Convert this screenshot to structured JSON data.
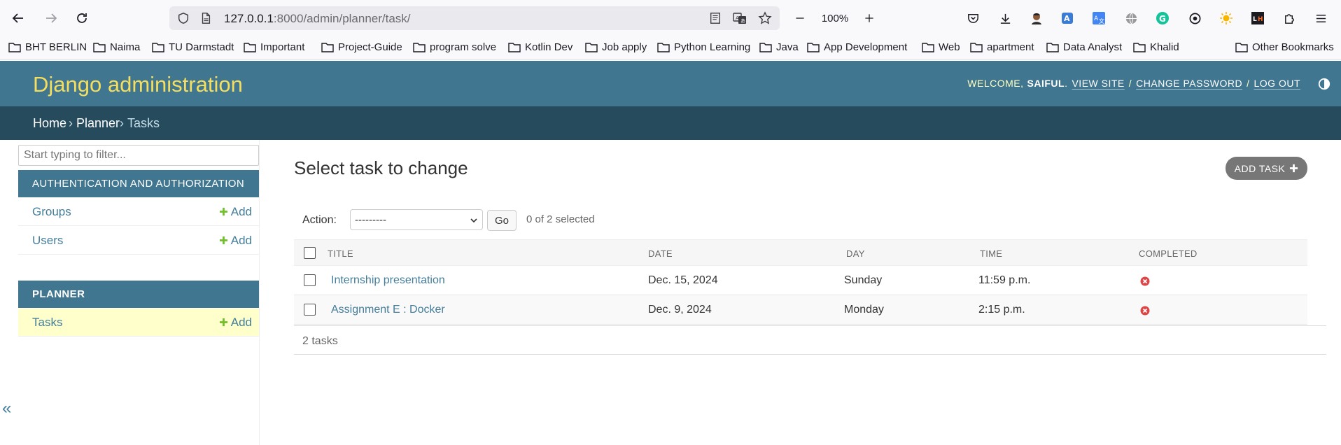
{
  "browser": {
    "url_host": "127.0.0.1",
    "url_rest": ":8000/admin/planner/task/",
    "zoom": "100%"
  },
  "bookmarks": [
    "BHT BERLIN",
    "Naima",
    "TU Darmstadt",
    "Important",
    "Project-Guide",
    "program solve",
    "Kotlin Dev",
    "Job apply",
    "Python Learning",
    "Java",
    "App Development",
    "Web",
    "apartment",
    "Data Analyst",
    "Khalid"
  ],
  "other_bookmarks": "Other Bookmarks",
  "header": {
    "brand": "Django administration",
    "welcome": "WELCOME,",
    "username": "SAIFUL",
    "view_site": "VIEW SITE",
    "change_password": "CHANGE PASSWORD",
    "log_out": "LOG OUT"
  },
  "breadcrumbs": {
    "home": "Home",
    "planner": "Planner",
    "current": "Tasks",
    "sep": "›"
  },
  "sidebar": {
    "filter_placeholder": "Start typing to filter...",
    "modules": [
      {
        "caption": "AUTHENTICATION AND AUTHORIZATION",
        "rows": [
          {
            "label": "Groups",
            "add": "Add"
          },
          {
            "label": "Users",
            "add": "Add"
          }
        ]
      },
      {
        "caption": "PLANNER",
        "rows": [
          {
            "label": "Tasks",
            "add": "Add"
          }
        ]
      }
    ],
    "collapse_glyph": "«"
  },
  "content": {
    "title": "Select task to change",
    "add_button": "ADD TASK",
    "action_label": "Action:",
    "action_selected": "---------",
    "go_label": "Go",
    "counter": "0 of 2 selected",
    "columns": [
      "TITLE",
      "DATE",
      "DAY",
      "TIME",
      "COMPLETED"
    ],
    "rows": [
      {
        "title": "Internship presentation",
        "date": "Dec. 15, 2024",
        "day": "Sunday",
        "time": "11:59 p.m.",
        "completed": false
      },
      {
        "title": "Assignment E : Docker",
        "date": "Dec. 9, 2024",
        "day": "Monday",
        "time": "2:15 p.m.",
        "completed": false
      }
    ],
    "total": "2 tasks"
  },
  "colors": {
    "header_bg": "#417690",
    "breadcrumb_bg": "#264b5d",
    "brand": "#f5dd5d",
    "link": "#447e9b",
    "add_green": "#70bf2b",
    "selected_row": "#ffffcc",
    "no_icon": "#dd4646"
  }
}
